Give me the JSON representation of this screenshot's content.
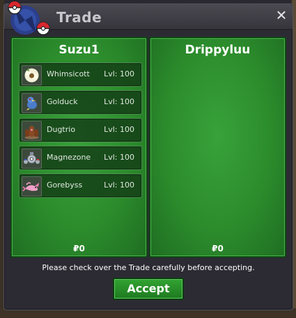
{
  "window": {
    "title": "Trade",
    "close_label": "✕"
  },
  "left_panel": {
    "trainer_name": "Suzu1",
    "money": "₽0",
    "pokemon": [
      {
        "name": "Whimsicott",
        "level": "Lvl: 100",
        "icon": "whimsicott-icon"
      },
      {
        "name": "Golduck",
        "level": "Lvl: 100",
        "icon": "golduck-icon"
      },
      {
        "name": "Dugtrio",
        "level": "Lvl: 100",
        "icon": "dugtrio-icon"
      },
      {
        "name": "Magnezone",
        "level": "Lvl: 100",
        "icon": "magnezone-icon"
      },
      {
        "name": "Gorebyss",
        "level": "Lvl: 100",
        "icon": "gorebyss-icon"
      }
    ]
  },
  "right_panel": {
    "trainer_name": "Drippyluu",
    "money": "₽0",
    "pokemon": []
  },
  "notice": "Please check over the Trade carefully before accepting.",
  "accept_label": "Accept",
  "colors": {
    "panel_green": "#2c8c2c",
    "button_green": "#32a332",
    "title_gray": "#c6c6cc"
  }
}
